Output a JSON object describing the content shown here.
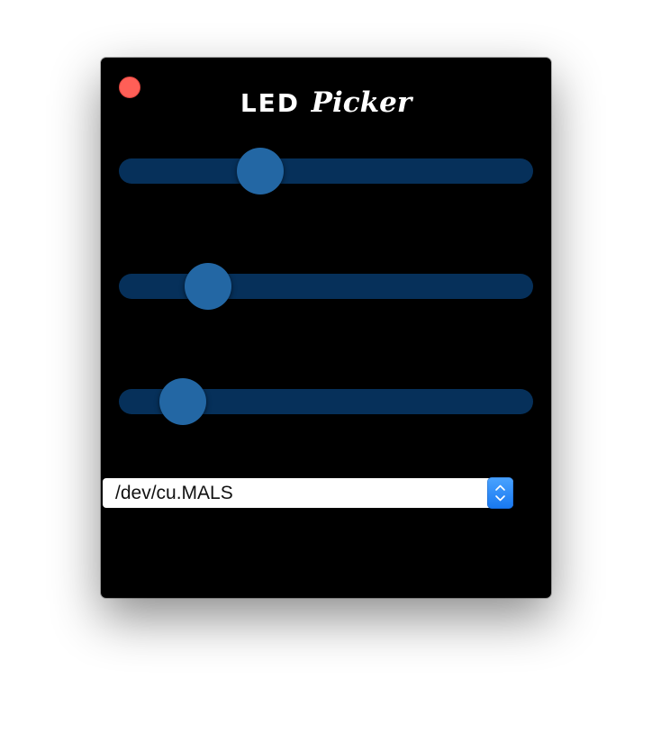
{
  "window": {
    "title_part1": "LED",
    "title_part2": "Picker",
    "close_icon": "close-icon"
  },
  "sliders": [
    {
      "name": "slider-1",
      "value_fraction": 0.32
    },
    {
      "name": "slider-2",
      "value_fraction": 0.18
    },
    {
      "name": "slider-3",
      "value_fraction": 0.11
    }
  ],
  "port_select": {
    "selected": "/dev/cu.MALS",
    "icon": "chevron-up-down-icon"
  },
  "colors": {
    "window_bg": "#000000",
    "slider_track": "#06305a",
    "slider_thumb": "#2367a4",
    "close_button": "#ff5f57",
    "select_accent": "#1878f0"
  }
}
